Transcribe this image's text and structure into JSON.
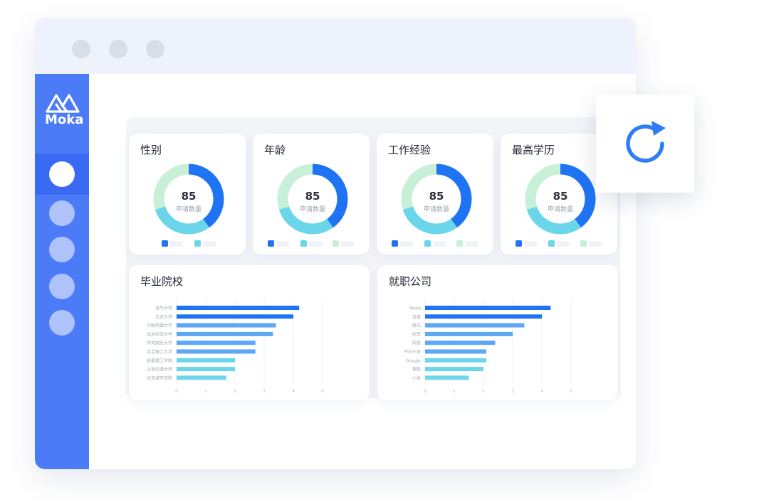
{
  "app": {
    "logo_text": "Moka"
  },
  "colors": {
    "accent": "#4c7bf8",
    "blue": "#1f74f4",
    "cyan": "#6bd6ea",
    "green": "#c8efd8",
    "bar_light": "#5ea7f4"
  },
  "icons": {
    "refresh": "refresh-icon",
    "logo": "moka-logo-icon"
  },
  "sidebar": {
    "items": [
      {
        "active": true
      },
      {
        "active": false
      },
      {
        "active": false
      },
      {
        "active": false
      },
      {
        "active": false
      }
    ]
  },
  "donut_cards": [
    {
      "title": "性别",
      "value": "85",
      "subtitle": "申请数量",
      "legend_count": 2
    },
    {
      "title": "年龄",
      "value": "85",
      "subtitle": "申请数量",
      "legend_count": 3
    },
    {
      "title": "工作经验",
      "value": "85",
      "subtitle": "申请数量",
      "legend_count": 3
    },
    {
      "title": "最高学历",
      "value": "85",
      "subtitle": "申请数量",
      "legend_count": 3
    }
  ],
  "chart_data": [
    {
      "type": "pie",
      "title": "性别",
      "center_value": 85,
      "center_label": "申请数量",
      "values": [
        0.4,
        0.3,
        0.3
      ],
      "colors": [
        "#1f74f4",
        "#6bd6ea",
        "#c8efd8"
      ]
    },
    {
      "type": "pie",
      "title": "年龄",
      "center_value": 85,
      "center_label": "申请数量",
      "values": [
        0.4,
        0.3,
        0.3
      ],
      "colors": [
        "#1f74f4",
        "#6bd6ea",
        "#c8efd8"
      ]
    },
    {
      "type": "pie",
      "title": "工作经验",
      "center_value": 85,
      "center_label": "申请数量",
      "values": [
        0.4,
        0.3,
        0.3
      ],
      "colors": [
        "#1f74f4",
        "#6bd6ea",
        "#c8efd8"
      ]
    },
    {
      "type": "pie",
      "title": "最高学历",
      "center_value": 85,
      "center_label": "申请数量",
      "values": [
        0.4,
        0.3,
        0.3
      ],
      "colors": [
        "#1f74f4",
        "#6bd6ea",
        "#c8efd8"
      ]
    },
    {
      "type": "bar",
      "orientation": "horizontal",
      "title": "毕业院校",
      "categories": [
        "清华大学",
        "北京大学",
        "中国传媒大学",
        "北京师范大学",
        "中央财经大学",
        "北京理工大学",
        "首都理工学院",
        "上海交通大学",
        "北京城市学院"
      ],
      "values": [
        4.2,
        4.0,
        3.4,
        3.3,
        2.7,
        2.7,
        2.0,
        2.0,
        1.7
      ],
      "xticks": [
        "0",
        "1",
        "2",
        "3",
        "4",
        "5"
      ],
      "xlim": [
        0,
        5
      ],
      "grid": true
    },
    {
      "type": "bar",
      "orientation": "horizontal",
      "title": "就职公司",
      "categories": [
        "Moka",
        "百度",
        "腾讯",
        "阿里",
        "网易",
        "今日头条",
        "Google",
        "搜狐",
        "小米"
      ],
      "values": [
        4.3,
        4.0,
        3.4,
        3.0,
        2.4,
        2.1,
        2.1,
        2.0,
        1.5
      ],
      "xticks": [
        "0",
        "1",
        "2",
        "3",
        "4",
        "5"
      ],
      "xlim": [
        0,
        5
      ],
      "grid": true
    }
  ]
}
